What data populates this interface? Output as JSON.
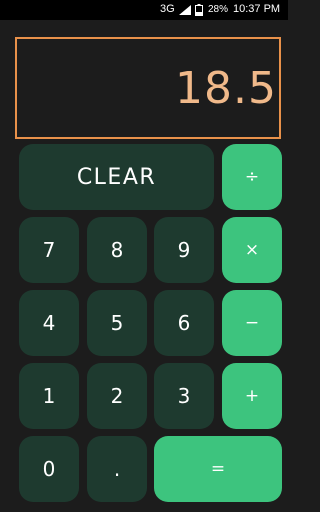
{
  "status_bar": {
    "network": "3G",
    "battery_percent": "28%",
    "time": "10:37 PM"
  },
  "display": {
    "value": "18.5"
  },
  "keys": {
    "clear": "CLEAR",
    "divide": "÷",
    "seven": "7",
    "eight": "8",
    "nine": "9",
    "multiply": "×",
    "four": "4",
    "five": "5",
    "six": "6",
    "minus": "−",
    "one": "1",
    "two": "2",
    "three": "3",
    "plus": "+",
    "zero": "0",
    "dot": ".",
    "equals": "="
  },
  "colors": {
    "background": "#1c1c1c",
    "number_key": "#1e3a2f",
    "operator_key": "#3dc47e",
    "display_border": "#e8914a",
    "display_text": "#f0b98a"
  }
}
